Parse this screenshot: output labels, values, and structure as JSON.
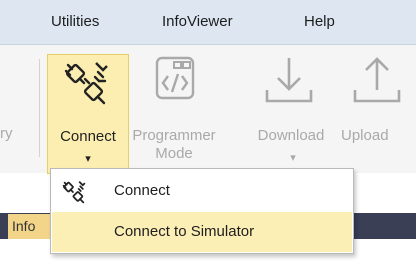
{
  "menubar": {
    "items": [
      "Utilities",
      "InfoViewer",
      "Help"
    ]
  },
  "ribbon": {
    "left_partial_label": "ry",
    "buttons": [
      {
        "label_lines": [
          "Connect"
        ],
        "icon": "plug-connect-icon",
        "enabled": true,
        "has_dropdown": true
      },
      {
        "label_lines": [
          "Programmer",
          "Mode"
        ],
        "icon": "code-window-icon",
        "enabled": false,
        "has_dropdown": false
      },
      {
        "label_lines": [
          "Download"
        ],
        "icon": "download-arrow-icon",
        "enabled": false,
        "has_dropdown": true
      },
      {
        "label_lines": [
          "Upload"
        ],
        "icon": "upload-arrow-icon",
        "enabled": false,
        "has_dropdown": false
      }
    ],
    "dropdown_arrow": "▾"
  },
  "dropdown": {
    "items": [
      {
        "label": "Connect",
        "icon": "plug-connect-icon"
      },
      {
        "label": "Connect to Simulator",
        "highlighted": true
      }
    ]
  },
  "tabs": {
    "active_tab_label": "Info"
  },
  "colors": {
    "accent_highlight": "#fbeeb0",
    "tab_bar": "#3a3f55",
    "menubar": "#dde6f1"
  }
}
